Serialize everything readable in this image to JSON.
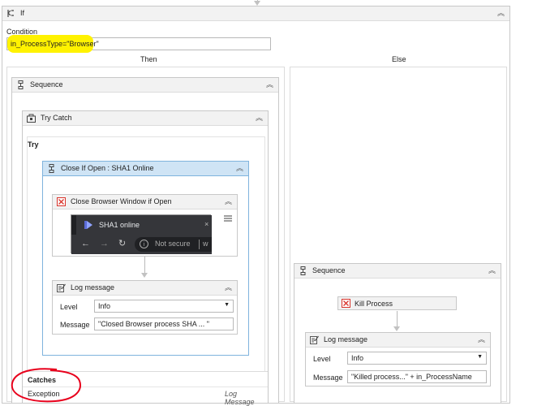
{
  "if_activity": {
    "title": "If",
    "condition_label": "Condition",
    "condition_value": "in_ProcessType=\"Browser\"",
    "then_label": "Then",
    "else_label": "Else"
  },
  "then_sequence": {
    "title": "Sequence"
  },
  "try_catch": {
    "title": "Try Catch",
    "try_label": "Try",
    "catches_label": "Catches",
    "exception_label": "Exception",
    "exception_action": "Log Message"
  },
  "close_if_open": {
    "title": "Close If Open : SHA1 Online"
  },
  "close_browser": {
    "title": "Close Browser Window if Open",
    "tab_title": "SHA1 online",
    "address_text": "Not secure",
    "address_suffix": "w"
  },
  "log_then": {
    "title": "Log message",
    "level_label": "Level",
    "level_value": "Info",
    "message_label": "Message",
    "message_value": "\"Closed Browser process SHA ... \""
  },
  "else_sequence": {
    "title": "Sequence"
  },
  "kill_process": {
    "title": "Kill Process"
  },
  "log_else": {
    "title": "Log message",
    "level_label": "Level",
    "level_value": "Info",
    "message_label": "Message",
    "message_value": "\"Killed process...\" + in_ProcessName"
  },
  "colors": {
    "highlight": "#fff200",
    "annotation_red": "#e8001c",
    "selected_header": "#cfe4f5",
    "selected_border": "#7fb3dd"
  }
}
